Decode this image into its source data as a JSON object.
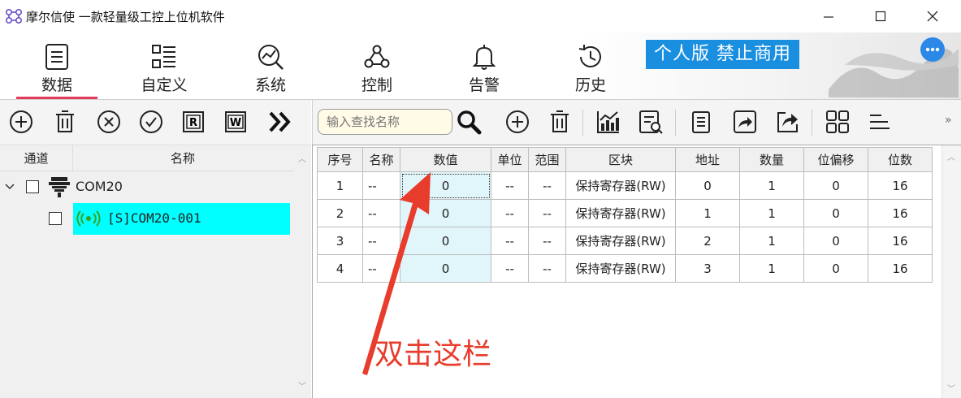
{
  "window": {
    "title": "摩尔信使   一款轻量级工控上位机软件",
    "logo_icon": "molecule-logo-icon",
    "controls": [
      "minimize-icon",
      "maximize-icon",
      "close-icon"
    ]
  },
  "ribbon": {
    "menu": [
      {
        "label": "数据",
        "icon": "list-doc-icon",
        "active": true
      },
      {
        "label": "自定义",
        "icon": "custom-list-icon",
        "active": false
      },
      {
        "label": "系统",
        "icon": "analytics-icon",
        "active": false
      },
      {
        "label": "控制",
        "icon": "webhook-icon",
        "active": false
      },
      {
        "label": "告警",
        "icon": "bell-icon",
        "active": false
      },
      {
        "label": "历史",
        "icon": "history-icon",
        "active": false
      }
    ],
    "banner": "个人版  禁止商用",
    "accent": "#e63a5a",
    "banner_color": "#1a8fe0"
  },
  "left_toolbar": {
    "buttons": [
      "add-icon",
      "delete-icon",
      "cancel-icon",
      "confirm-icon",
      "read-icon",
      "write-icon",
      "more-double-chevron-icon"
    ],
    "read_letter": "R",
    "write_letter": "W"
  },
  "tree": {
    "headers": {
      "channel": "通道",
      "name": "名称"
    },
    "root": {
      "label": "COM20",
      "icon": "serial-port-icon"
    },
    "device": {
      "label": "[S]COM20-001",
      "icon": "signal-icon",
      "highlight": "#00ffff"
    }
  },
  "right_toolbar": {
    "search_placeholder": "输入查找名称",
    "buttons": [
      "search-icon",
      "add-icon",
      "delete-icon",
      "chart-icon",
      "data-search-icon",
      "copy-icon",
      "forward-icon",
      "share-icon",
      "grid-icon",
      "align-icon"
    ],
    "expand": "»"
  },
  "table": {
    "headers": [
      "序号",
      "名称",
      "数值",
      "单位",
      "范围",
      "区块",
      "地址",
      "数量",
      "位偏移",
      "位数"
    ],
    "rows": [
      [
        "1",
        "--",
        "0",
        "--",
        "--",
        "保持寄存器(RW)",
        "0",
        "1",
        "0",
        "16"
      ],
      [
        "2",
        "--",
        "0",
        "--",
        "--",
        "保持寄存器(RW)",
        "1",
        "1",
        "0",
        "16"
      ],
      [
        "3",
        "--",
        "0",
        "--",
        "--",
        "保持寄存器(RW)",
        "2",
        "1",
        "0",
        "16"
      ],
      [
        "4",
        "--",
        "0",
        "--",
        "--",
        "保持寄存器(RW)",
        "3",
        "1",
        "0",
        "16"
      ]
    ]
  },
  "annotation": {
    "text": "双击这栏",
    "color": "#e83c2c"
  }
}
